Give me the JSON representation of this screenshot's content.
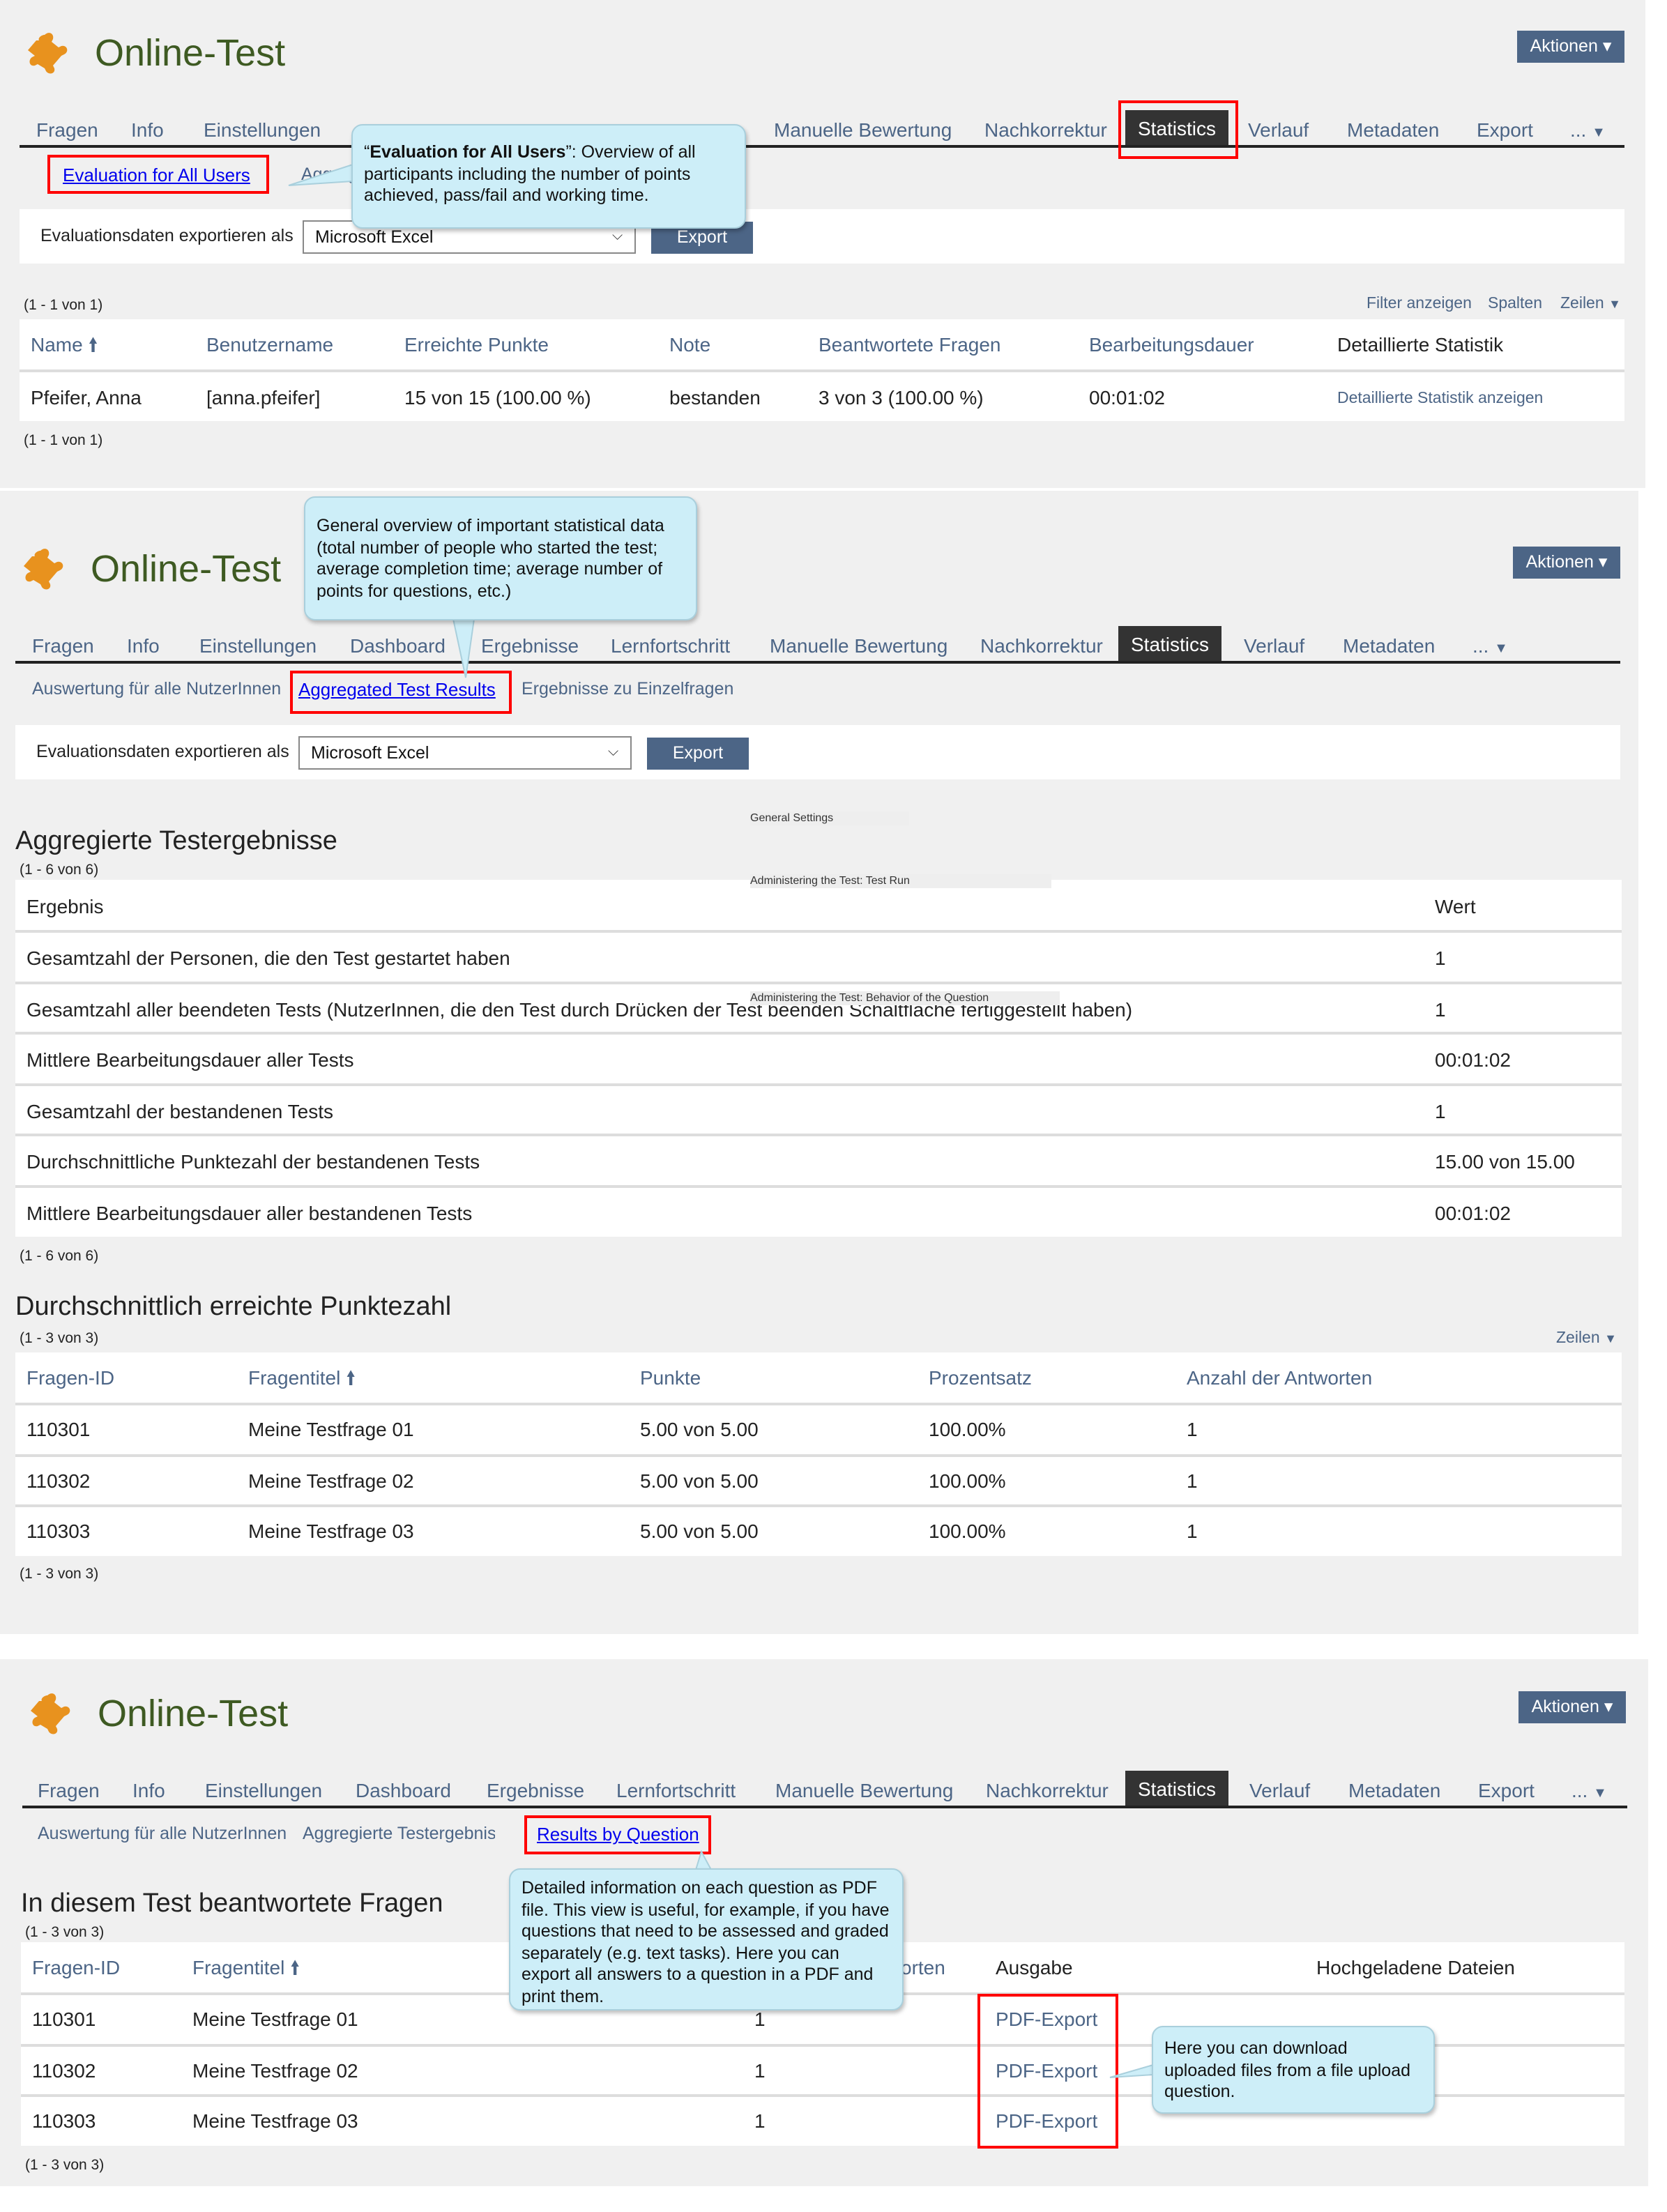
{
  "colors": {
    "accent": "#4c6586",
    "title": "#3e5a22",
    "logo": "#e8921e",
    "highlight": "#ff0000",
    "tooltip": "#cdeef8",
    "link": "#0000ee"
  },
  "app": {
    "title": "Online-Test",
    "logo_icon": "puzzle-piece-icon",
    "actions_label": "Aktionen"
  },
  "tabs": [
    "Fragen",
    "Info",
    "Einstellungen",
    "Dashboard",
    "Ergebnisse",
    "Lernfortschritt",
    "Manuelle Bewertung",
    "Nachkorrektur",
    "Statistics",
    "Verlauf",
    "Metadaten",
    "Export",
    "..."
  ],
  "export_bar": {
    "label": "Evaluationsdaten exportieren als",
    "format": "Microsoft Excel",
    "button": "Export"
  },
  "panel1": {
    "subtabs": [
      "Evaluation for All Users",
      "Aggregierte Testergebnisse"
    ],
    "count": "(1 - 1 von 1)",
    "controls": [
      "Filter anzeigen",
      "Spalten",
      "Zeilen"
    ],
    "columns": [
      "Name",
      "Benutzername",
      "Erreichte Punkte",
      "Note",
      "Beantwortete Fragen",
      "Bearbeitungsdauer",
      "Detaillierte Statistik"
    ],
    "rows": [
      [
        "Pfeifer, Anna",
        "[anna.pfeifer]",
        "15 von 15 (100.00 %)",
        "bestanden",
        "3 von 3 (100.00 %)",
        "00:01:02",
        "Detaillierte Statistik anzeigen"
      ]
    ],
    "tooltip_bold": "Evaluation for All Users",
    "tooltip_text": ": Overview of all participants including the number of points achieved, pass/fail and working time."
  },
  "panel2": {
    "subtabs": [
      "Auswertung für alle NutzerInnen",
      "Aggregated Test Results",
      "Ergebnisse zu Einzelfragen"
    ],
    "tooltip": "General overview of important statistical data (total number of people who started the test; average completion time; average number of points for questions, etc.)",
    "overlays": [
      "General Settings",
      "Administering the Test: Test Run",
      "Administering the Test: Behavior of the Question"
    ],
    "agg_title": "Aggregierte Testergebnisse",
    "agg_count": "(1 - 6 von 6)",
    "agg_columns": [
      "Ergebnis",
      "Wert"
    ],
    "agg_rows": [
      [
        "Gesamtzahl der Personen, die den Test gestartet haben",
        "1"
      ],
      [
        "Gesamtzahl aller beendeten Tests (NutzerInnen, die den Test durch Drücken der Test beenden Schaltfläche fertiggestellt haben)",
        "1"
      ],
      [
        "Mittlere Bearbeitungsdauer aller Tests",
        "00:01:02"
      ],
      [
        "Gesamtzahl der bestandenen Tests",
        "1"
      ],
      [
        "Durchschnittliche Punktezahl der bestandenen Tests",
        "15.00 von 15.00"
      ],
      [
        "Mittlere Bearbeitungsdauer aller bestandenen Tests",
        "00:01:02"
      ]
    ],
    "avg_title": "Durchschnittlich erreichte Punktezahl",
    "avg_count": "(1 - 3 von 3)",
    "avg_rows_control": "Zeilen",
    "avg_columns": [
      "Fragen-ID",
      "Fragentitel",
      "Punkte",
      "Prozentsatz",
      "Anzahl der Antworten"
    ],
    "avg_rows": [
      [
        "110301",
        "Meine Testfrage 01",
        "5.00 von 5.00",
        "100.00%",
        "1"
      ],
      [
        "110302",
        "Meine Testfrage 02",
        "5.00 von 5.00",
        "100.00%",
        "1"
      ],
      [
        "110303",
        "Meine Testfrage 03",
        "5.00 von 5.00",
        "100.00%",
        "1"
      ]
    ]
  },
  "panel3": {
    "subtabs": [
      "Auswertung für alle NutzerInnen",
      "Aggregierte Testergebniss",
      "Results by Question"
    ],
    "title": "In diesem Test beantwortete Fragen",
    "count": "(1 - 3 von 3)",
    "columns": [
      "Fragen-ID",
      "Fragentitel",
      "orten",
      "Ausgabe",
      "Hochgeladene Dateien"
    ],
    "rows": [
      [
        "110301",
        "Meine Testfrage 01",
        "1",
        "PDF-Export"
      ],
      [
        "110302",
        "Meine Testfrage 02",
        "1",
        "PDF-Export"
      ],
      [
        "110303",
        "Meine Testfrage 03",
        "1",
        "PDF-Export"
      ]
    ],
    "tooltip_question": "Detailed information on each question as PDF file. This view is useful, for example, if you have questions that need to be assessed and graded separately (e.g. text tasks). Here you can export all answers to a question in a PDF and print them.",
    "tooltip_upload": "Here you can download uploaded files from a file upload question."
  }
}
